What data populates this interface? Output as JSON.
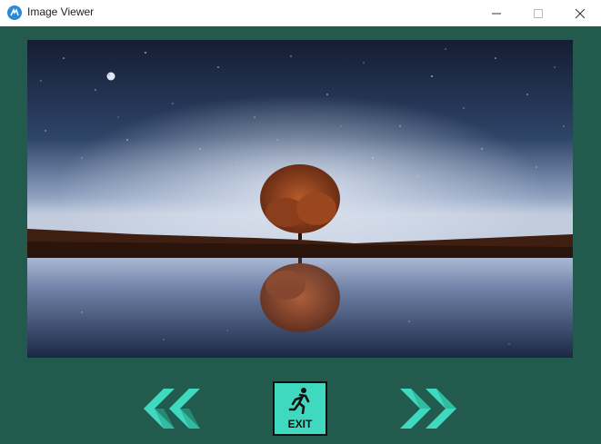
{
  "window": {
    "title": "Image Viewer",
    "controls": [
      "minimize-icon",
      "maximize-icon",
      "close-icon"
    ]
  },
  "viewer": {
    "image_subject": "lone tree reflected in lake under starry night sky"
  },
  "toolbar": {
    "back_icon": "double-chevron-left-icon",
    "exit_icon": "running-man-exit-icon",
    "exit_label": "EXIT",
    "forward_icon": "double-chevron-right-icon"
  },
  "colors": {
    "background": "#225b4d",
    "accent": "#3ed9bf",
    "titlebar": "#ffffff"
  }
}
